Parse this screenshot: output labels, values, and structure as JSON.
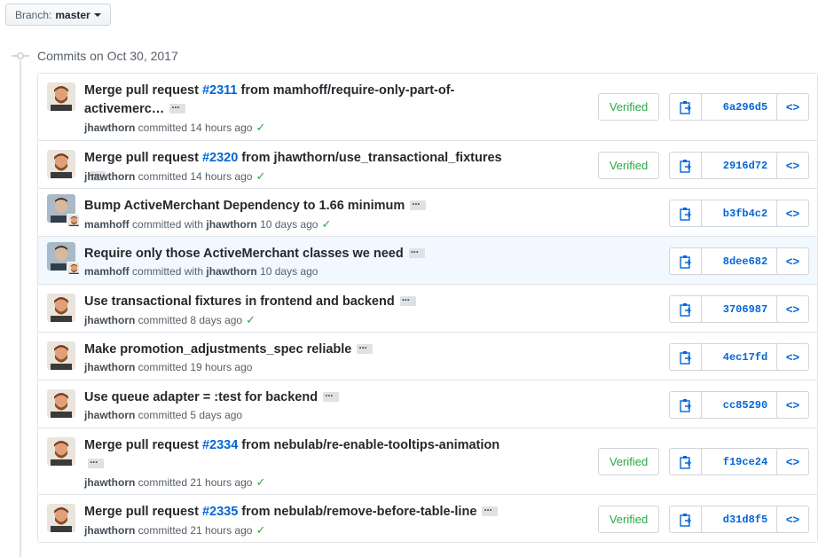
{
  "branch": {
    "label": "Branch:",
    "value": "master"
  },
  "group": {
    "title": "Commits on Oct 30, 2017"
  },
  "commits": [
    {
      "msg_pre": "Merge pull request ",
      "pr": "#2311",
      "msg_post": " from mamhoff/require-only-part-of-activemerc…",
      "author": "jhawthorn",
      "committer": "",
      "when": "14 hours ago",
      "check": true,
      "verified": "Verified",
      "sha": "6a296d5",
      "avatar": "bearded",
      "height": 75
    },
    {
      "msg_pre": "Merge pull request ",
      "pr": "#2320",
      "msg_post": " from jhawthorn/use_transactional_fixtures",
      "author": "jhawthorn",
      "committer": "",
      "when": "14 hours ago",
      "check": true,
      "verified": "Verified",
      "sha": "2916d72",
      "avatar": "bearded",
      "height": 54
    },
    {
      "msg_pre": "Bump ActiveMerchant Dependency to 1.66 minimum",
      "pr": "",
      "msg_post": "",
      "author": "mamhoff",
      "committer": "jhawthorn",
      "when": "10 days ago",
      "check": true,
      "verified": "",
      "sha": "b3fb4c2",
      "avatar": "stack",
      "height": 54
    },
    {
      "msg_pre": "Require only those ActiveMerchant classes we need",
      "pr": "",
      "msg_post": "",
      "author": "mamhoff",
      "committer": "jhawthorn",
      "when": "10 days ago",
      "check": false,
      "verified": "",
      "sha": "8dee682",
      "avatar": "stack",
      "height": 54,
      "highlight": true
    },
    {
      "msg_pre": "Use transactional fixtures in frontend and backend",
      "pr": "",
      "msg_post": "",
      "author": "jhawthorn",
      "committer": "",
      "when": "8 days ago",
      "check": true,
      "verified": "",
      "sha": "3706987",
      "avatar": "bearded",
      "height": 54
    },
    {
      "msg_pre": "Make promotion_adjustments_spec reliable",
      "pr": "",
      "msg_post": "",
      "author": "jhawthorn",
      "committer": "",
      "when": "19 hours ago",
      "check": false,
      "verified": "",
      "sha": "4ec17fd",
      "avatar": "bearded",
      "height": 54
    },
    {
      "msg_pre": "Use queue adapter = :test for backend",
      "pr": "",
      "msg_post": "",
      "author": "jhawthorn",
      "committer": "",
      "when": "5 days ago",
      "check": false,
      "verified": "",
      "sha": "cc85290",
      "avatar": "bearded",
      "height": 54
    },
    {
      "msg_pre": "Merge pull request ",
      "pr": "#2334",
      "msg_post": " from nebulab/re-enable-tooltips-animation",
      "author": "jhawthorn",
      "committer": "",
      "when": "21 hours ago",
      "check": true,
      "verified": "Verified",
      "sha": "f19ce24",
      "avatar": "bearded",
      "height": 75,
      "ellipsis_newline": true
    },
    {
      "msg_pre": "Merge pull request ",
      "pr": "#2335",
      "msg_post": " from nebulab/remove-before-table-line",
      "author": "jhawthorn",
      "committer": "",
      "when": "21 hours ago",
      "check": true,
      "verified": "Verified",
      "sha": "d31d8f5",
      "avatar": "bearded",
      "height": 54
    }
  ],
  "strings": {
    "committed": "committed",
    "committed_with": "committed with",
    "check_mark": "✓",
    "browse": "<>"
  },
  "colors": {
    "link": "#0366d6",
    "verified": "#28a745",
    "check": "#28a745",
    "highlight": "#f1f8ff"
  }
}
